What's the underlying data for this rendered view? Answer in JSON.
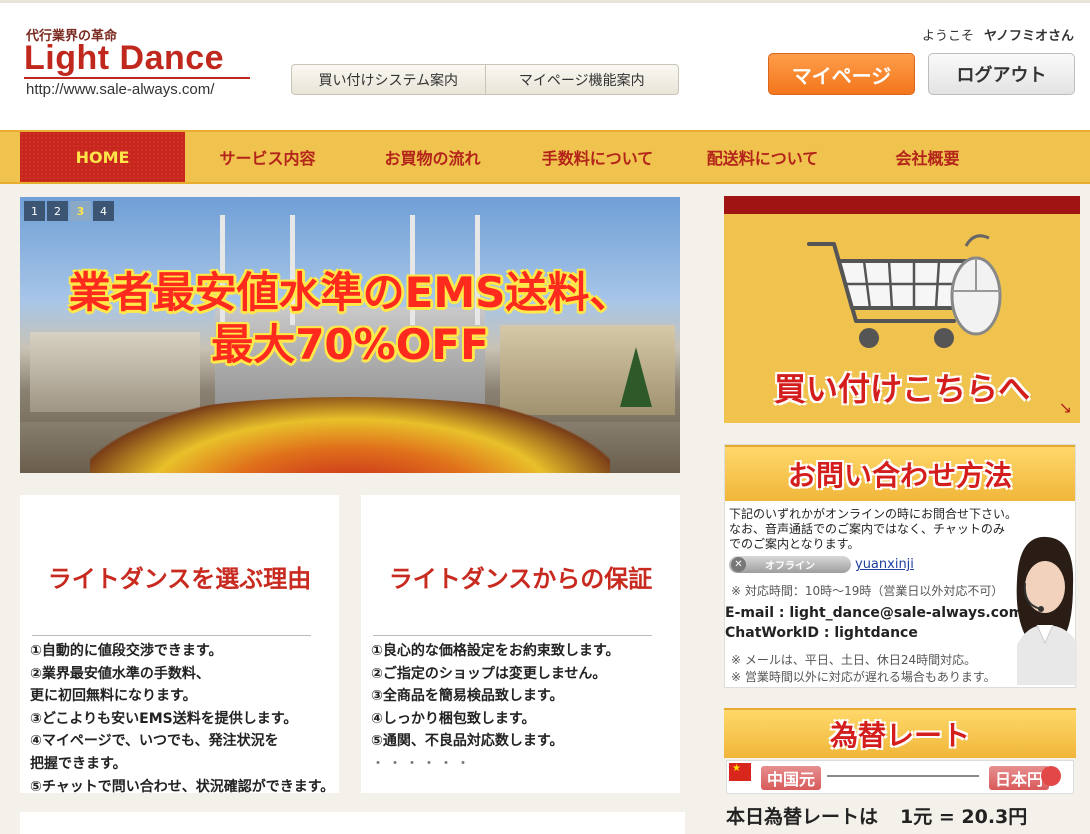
{
  "header": {
    "tagline": "代行業界の革命",
    "brand": "Light Dance",
    "url": "http://www.sale-always.com/",
    "subnav": [
      "買い付けシステム案内",
      "マイページ機能案内"
    ],
    "welcome_prefix": "ようこそ",
    "user_name": "ヤノフミオさん",
    "mypage_label": "マイページ",
    "logout_label": "ログアウト"
  },
  "nav": {
    "items": [
      "HOME",
      "サービス内容",
      "お買物の流れ",
      "手数料について",
      "配送料について",
      "会社概要"
    ],
    "active": "HOME"
  },
  "hero": {
    "pages": [
      "1",
      "2",
      "3",
      "4"
    ],
    "active_page": "3",
    "headline_1": "業者最安値水準のEMS送料、",
    "headline_2": "最大70%OFF"
  },
  "reasons": {
    "title": "ライトダンスを選ぶ理由",
    "items": [
      "①自動的に値段交渉できます。",
      "②業界最安値水準の手数料、",
      "更に初回無料になります。",
      "③どこよりも安いEMS送料を提供します。",
      "④マイページで、いつでも、発注状況を",
      "把握できます。",
      "⑤チャットで問い合わせ、状況確認ができます。"
    ]
  },
  "guarantee": {
    "title": "ライトダンスからの保証",
    "items": [
      "①良心的な価格設定をお約束致します。",
      "②ご指定のショップは変更しません。",
      "③全商品を簡易検品致します。",
      "④しっかり梱包致します。",
      "⑤通関、不良品対応数します。"
    ],
    "ellipsis": "・・・・・・"
  },
  "sidebar": {
    "buy_caption": "買い付けこちらへ",
    "buy_arrow": "↘",
    "contact": {
      "title": "お問い合わせ方法",
      "desc_1": "下記のいずれかがオンラインの時にお問合せ下さい。",
      "desc_2": "なお、音声通話でのご案内ではなく、チャットのみ",
      "desc_3": "でのご案内となります。",
      "status": "オフライン",
      "skype_id": "yuanxinji",
      "hours": "※ 対応時間：10時～19時（営業日以外対応不可）",
      "email": "E-mail : light_dance@sale-always.com",
      "chatwork": "ChatWorkID : lightdance",
      "note_1": "※ メールは、平日、土日、休日24時間対応。",
      "note_2": "※ 営業時間以外に対応が遅れる場合もあります。"
    },
    "rate": {
      "title": "為替レート",
      "from": "中国元",
      "to": "日本円",
      "today_label": "本日為替レートは",
      "today_value": "1元 = 20.3円"
    }
  },
  "colors": {
    "brand_red": "#c0281e",
    "nav_yellow": "#f0c24e",
    "mypage_orange": "#f2761c"
  }
}
